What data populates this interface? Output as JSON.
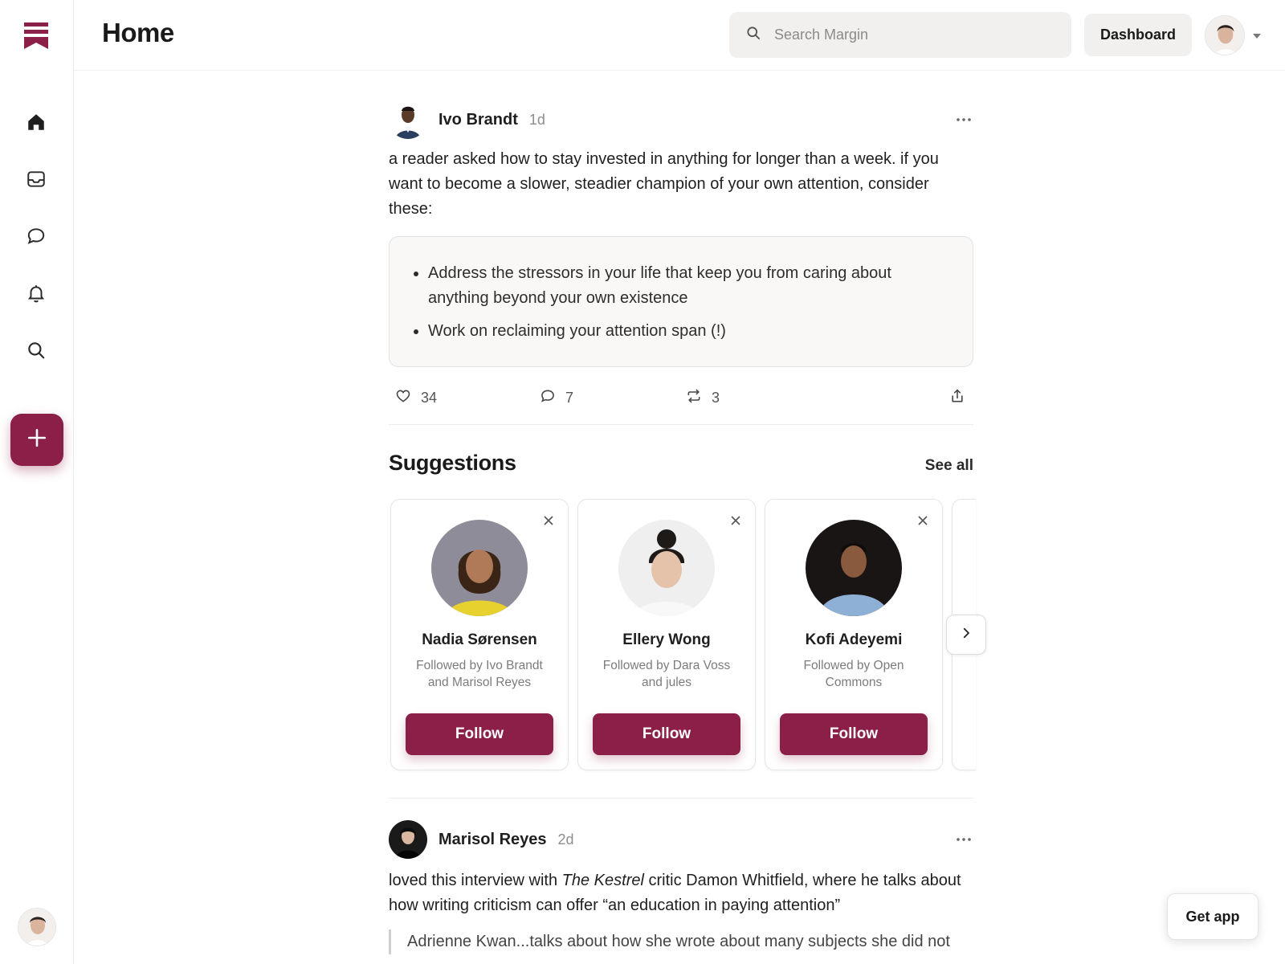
{
  "app": {
    "brand_color": "#8c1f48"
  },
  "header": {
    "title": "Home",
    "search_placeholder": "Search Margin",
    "dashboard_label": "Dashboard"
  },
  "sidebar": {
    "items": [
      {
        "name": "home",
        "icon": "home-icon"
      },
      {
        "name": "inbox",
        "icon": "inbox-icon"
      },
      {
        "name": "chat",
        "icon": "chat-icon"
      },
      {
        "name": "notifications",
        "icon": "bell-icon"
      },
      {
        "name": "search",
        "icon": "search-icon"
      }
    ],
    "compose_icon": "plus-icon"
  },
  "posts": [
    {
      "author": "Ivo Brandt",
      "time": "1d",
      "text": "a reader asked how to stay invested in anything for longer than a week. if you want to become a slower, steadier champion of your own attention, consider these:",
      "bullets": [
        "Address the stressors in your life that keep you from caring about anything beyond your own existence",
        "Work on reclaiming your attention span (!)"
      ],
      "likes": "34",
      "comments": "7",
      "restacks": "3"
    },
    {
      "author": "Marisol Reyes",
      "time": "2d",
      "text_before": "loved this interview with ",
      "text_italic": "The Kestrel",
      "text_after": " critic Damon Whitfield, where he talks about how writing criticism can offer “an education in paying attention”",
      "quote": "Adrienne Kwan...talks about how she wrote about many subjects she did not"
    }
  ],
  "suggestions": {
    "title": "Suggestions",
    "see_all": "See all",
    "cards": [
      {
        "name": "Nadia Sørensen",
        "followed_by": "Followed by Ivo Brandt and Marisol Reyes",
        "button": "Follow"
      },
      {
        "name": "Ellery Wong",
        "followed_by": "Followed by Dara Voss and jules",
        "button": "Follow"
      },
      {
        "name": "Kofi Adeyemi",
        "followed_by": "Followed by Open Commons",
        "button": "Follow"
      }
    ]
  },
  "get_app": "Get app"
}
